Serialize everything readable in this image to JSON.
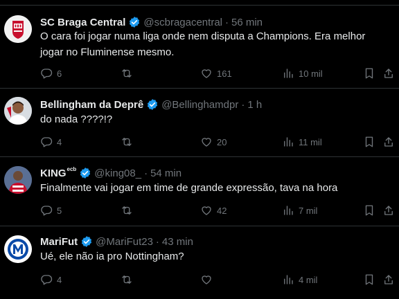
{
  "tweets": [
    {
      "name": "SC Braga Central",
      "name_sup": "",
      "handle": "@scbragacentral",
      "time": "56 min",
      "text": "O cara foi jogar numa liga onde nem disputa a Champions. Era melhor jogar no Fluminense mesmo.",
      "replies": "6",
      "retweets": "",
      "likes": "161",
      "views": "10 mil",
      "avatar": "braga-crest"
    },
    {
      "name": "Bellingham da Deprê",
      "name_sup": "",
      "handle": "@Bellinghamdpr",
      "time": "1 h",
      "text": "do nada ????!?",
      "replies": "4",
      "retweets": "",
      "likes": "20",
      "views": "11 mil",
      "avatar": "player-photo"
    },
    {
      "name": "KING",
      "name_sup": "ecb",
      "handle": "@king08_",
      "time": "54 min",
      "text": "Finalmente vai jogar em time de grande expressão, tava na hora",
      "replies": "5",
      "retweets": "",
      "likes": "42",
      "views": "7 mil",
      "avatar": "player-photo-red"
    },
    {
      "name": "MariFut",
      "name_sup": "",
      "handle": "@MariFut23",
      "time": "43 min",
      "text": "Ué, ele não ia pro Nottingham?",
      "replies": "4",
      "retweets": "",
      "likes": "",
      "views": "4 mil",
      "avatar": "m-logo"
    }
  ],
  "colors": {
    "background": "#000000",
    "text": "#e7e9ea",
    "muted": "#71767b",
    "border": "#2f3336",
    "verified": "#1d9bf0"
  }
}
